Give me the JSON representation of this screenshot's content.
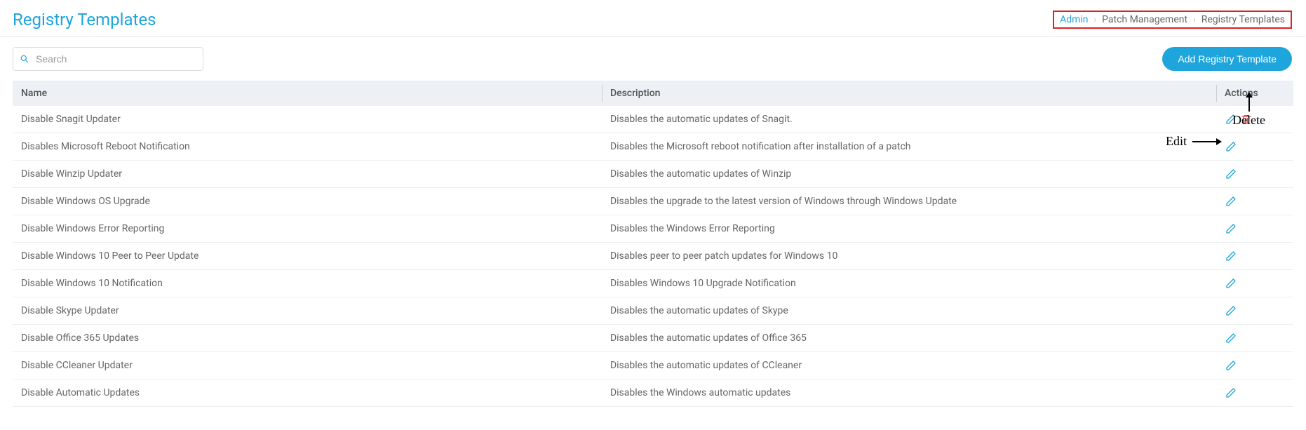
{
  "header": {
    "title": "Registry Templates"
  },
  "breadcrumb": {
    "items": [
      "Admin",
      "Patch Management",
      "Registry Templates"
    ]
  },
  "search": {
    "placeholder": "Search",
    "value": ""
  },
  "actions": {
    "add_label": "Add Registry Template"
  },
  "table": {
    "columns": {
      "name": "Name",
      "description": "Description",
      "actions": "Actions"
    },
    "rows": [
      {
        "name": "Disable Snagit Updater",
        "description": "Disables the automatic updates of Snagit.",
        "has_delete": true
      },
      {
        "name": "Disables Microsoft Reboot Notification",
        "description": "Disables the Microsoft reboot notification after installation of a patch",
        "has_delete": false
      },
      {
        "name": "Disable Winzip Updater",
        "description": "Disables the automatic updates of Winzip",
        "has_delete": false
      },
      {
        "name": "Disable Windows OS Upgrade",
        "description": "Disables the upgrade to the latest version of Windows through Windows Update",
        "has_delete": false
      },
      {
        "name": "Disable Windows Error Reporting",
        "description": "Disables the Windows Error Reporting",
        "has_delete": false
      },
      {
        "name": "Disable Windows 10 Peer to Peer Update",
        "description": "Disables peer to peer patch updates for Windows 10",
        "has_delete": false
      },
      {
        "name": "Disable Windows 10 Notification",
        "description": "Disables Windows 10 Upgrade Notification",
        "has_delete": false
      },
      {
        "name": "Disable Skype Updater",
        "description": "Disables the automatic updates of Skype",
        "has_delete": false
      },
      {
        "name": "Disable Office 365 Updates",
        "description": "Disables the automatic updates of Office 365",
        "has_delete": false
      },
      {
        "name": "Disable CCleaner Updater",
        "description": "Disables the automatic updates of CCleaner",
        "has_delete": false
      },
      {
        "name": "Disable Automatic Updates",
        "description": "Disables the Windows automatic updates",
        "has_delete": false
      }
    ]
  },
  "annotations": {
    "edit_label": "Edit",
    "delete_label": "Delete"
  }
}
